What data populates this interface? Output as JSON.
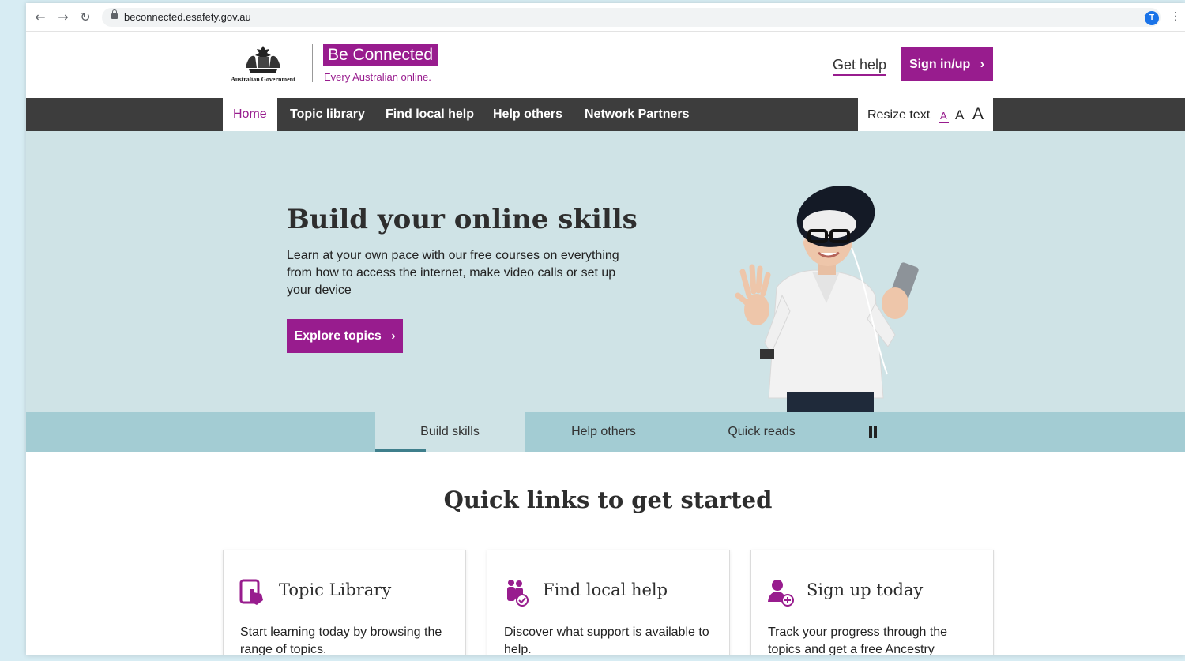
{
  "browser": {
    "url": "beconnected.esafety.gov.au",
    "profile_initial": "T"
  },
  "header": {
    "gov_label": "Australian Government",
    "brand": "Be Connected",
    "tagline": "Every Australian online.",
    "get_help": "Get help",
    "sign_in": "Sign in/up"
  },
  "nav": {
    "items": [
      {
        "label": "Home"
      },
      {
        "label": "Topic library"
      },
      {
        "label": "Find local help"
      },
      {
        "label": "Help others"
      },
      {
        "label": "Network Partners"
      }
    ],
    "resize_label": "Resize text",
    "resize_small": "A",
    "resize_medium": "A",
    "resize_large": "A"
  },
  "hero": {
    "title": "Build your online skills",
    "description": "Learn at your own pace with our free courses on everything from how to access the internet, make video calls or set up your device",
    "button": "Explore topics"
  },
  "tabs": {
    "items": [
      {
        "label": "Build skills"
      },
      {
        "label": "Help others"
      },
      {
        "label": "Quick reads"
      }
    ]
  },
  "quick_links": {
    "title": "Quick links to get started",
    "cards": [
      {
        "title": "Topic Library",
        "text": "Start learning today by browsing the range of topics."
      },
      {
        "title": "Find local help",
        "text": "Discover what support is available to help."
      },
      {
        "title": "Sign up today",
        "text": "Track your progress through the topics and get a free Ancestry"
      }
    ]
  },
  "colors": {
    "brand_purple": "#981c8e",
    "nav_dark": "#3d3d3d",
    "hero_bg": "#cfe3e6",
    "tabs_bg": "#a3ccd3"
  }
}
